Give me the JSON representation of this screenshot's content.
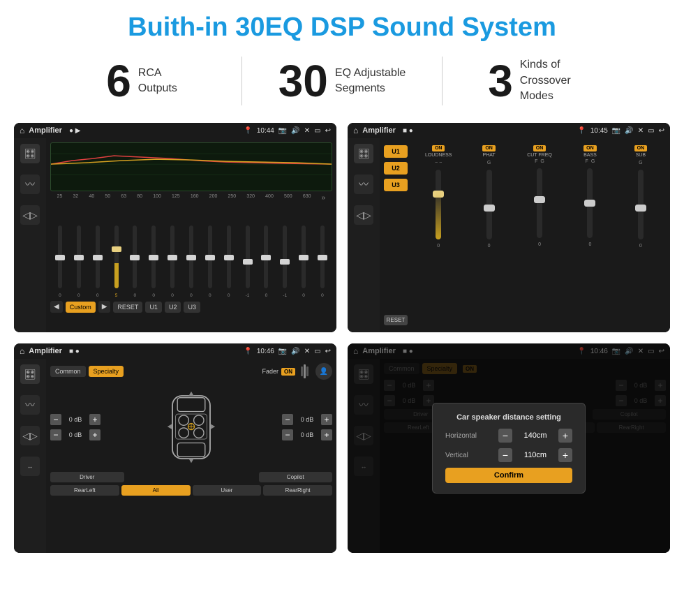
{
  "header": {
    "title": "Buith-in 30EQ DSP Sound System"
  },
  "stats": [
    {
      "number": "6",
      "label": "RCA\nOutputs"
    },
    {
      "number": "30",
      "label": "EQ Adjustable\nSegments"
    },
    {
      "number": "3",
      "label": "Kinds of\nCrossover Modes"
    }
  ],
  "screens": [
    {
      "id": "eq-screen",
      "statusBar": {
        "title": "Amplifier",
        "icons": "▶",
        "time": "10:44"
      },
      "type": "eq"
    },
    {
      "id": "amp-screen",
      "statusBar": {
        "title": "Amplifier",
        "icons": "■ ●",
        "time": "10:45"
      },
      "type": "amp"
    },
    {
      "id": "speaker-screen",
      "statusBar": {
        "title": "Amplifier",
        "icons": "■ ●",
        "time": "10:46"
      },
      "type": "speaker"
    },
    {
      "id": "dialog-screen",
      "statusBar": {
        "title": "Amplifier",
        "icons": "■ ●",
        "time": "10:46"
      },
      "type": "dialog",
      "dialog": {
        "title": "Car speaker distance setting",
        "horizontal_label": "Horizontal",
        "horizontal_value": "140cm",
        "vertical_label": "Vertical",
        "vertical_value": "110cm",
        "confirm_label": "Confirm"
      }
    }
  ],
  "eq": {
    "frequencies": [
      "25",
      "32",
      "40",
      "50",
      "63",
      "80",
      "100",
      "125",
      "160",
      "200",
      "250",
      "320",
      "400",
      "500",
      "630"
    ],
    "values": [
      "0",
      "0",
      "0",
      "5",
      "0",
      "0",
      "0",
      "0",
      "0",
      "0",
      "-1",
      "0",
      "-1",
      "0",
      "0"
    ],
    "buttons": [
      "Custom",
      "RESET",
      "U1",
      "U2",
      "U3"
    ]
  },
  "amp": {
    "u_buttons": [
      "U1",
      "U2",
      "U3"
    ],
    "channels": [
      "LOUDNESS",
      "PHAT",
      "CUT FREQ",
      "BASS",
      "SUB"
    ],
    "on_labels": [
      "ON",
      "ON",
      "ON",
      "ON",
      "ON"
    ]
  },
  "speaker": {
    "tabs": [
      "Common",
      "Specialty"
    ],
    "active_tab": "Specialty",
    "fader_label": "Fader",
    "on_label": "ON",
    "db_rows": [
      {
        "value": "0 dB"
      },
      {
        "value": "0 dB"
      },
      {
        "value": "0 dB"
      },
      {
        "value": "0 dB"
      }
    ],
    "bottom_buttons": [
      "Driver",
      "",
      "Copilot",
      "RearLeft",
      "All",
      "User",
      "RearRight"
    ]
  }
}
